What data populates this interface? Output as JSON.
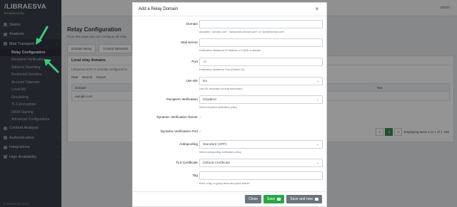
{
  "app": {
    "logo": "/LIBRAESVA",
    "subtitle": "EmailSecurity",
    "footer": "© Libraesva 2024"
  },
  "sidebar": {
    "items": [
      {
        "label": "Status",
        "icon": "gauge-icon"
      },
      {
        "label": "Analysis",
        "icon": "chart-icon"
      },
      {
        "label": "Mail Transport",
        "icon": "envelope-icon",
        "open": true
      }
    ],
    "subitems": [
      "Relay Configuration",
      "Recipient Verification",
      "Address Rewriting",
      "Restricted Senders",
      "Account Takeover",
      "Local MX",
      "Greylisting",
      "TLS Encryption",
      "DKIM Signing",
      "Advanced Configuration"
    ],
    "items_after": [
      {
        "label": "Content Analysis",
        "icon": "filter-icon"
      },
      {
        "label": "Authentication",
        "icon": "key-icon"
      },
      {
        "label": "Integrations",
        "icon": "plug-icon"
      },
      {
        "label": "High Availability",
        "icon": "cluster-icon"
      }
    ]
  },
  "topbar": {
    "user": "admin"
  },
  "page": {
    "title": "Relay Configuration",
    "description": "From this page you can configure all relay",
    "tabs": [
      "Domain Relay",
      "Trusted Networks"
    ],
    "card_title": "Local relay domains",
    "card_desc": "Libraesva ESG is actually configured to",
    "toolbar": [
      "New",
      "Search",
      "Export"
    ],
    "table_headers": [
      "Domain",
      "Mail Server",
      "Port",
      "Tag",
      "Test"
    ],
    "table_row": [
      "eample.com",
      "",
      "",
      "",
      ""
    ],
    "pager_text": "Displaying items 1 to 1 of 1",
    "pager_pages": [
      "1"
    ],
    "page_size": "100"
  },
  "modal": {
    "title": "Add a Relay Domain",
    "fields": {
      "domain": {
        "label": "Domain",
        "value": "",
        "help": "Accepted: \"domain.com\", \"subdomain.domain.com\" or \"user@domain.com\""
      },
      "mailserver": {
        "label": "Mail Server",
        "value": "",
        "help": "Destination Mailserver IP Address or FQDN or domain"
      },
      "port": {
        "label": "Port",
        "placeholder": "25",
        "help": "Destination Mailserver Port (Default 25)"
      },
      "use_mx": {
        "label": "Use MX",
        "value": "No",
        "help": "Use MX resolution for final destination"
      },
      "recipient_verification": {
        "label": "Recipient Verification",
        "value": "Disabled",
        "help": "Select recipient verification policy"
      },
      "dyn_server": {
        "label": "Dynamic Verification Server",
        "value": "–"
      },
      "dyn_port": {
        "label": "Dynamic Verification Port",
        "value": "–"
      },
      "antispoofing": {
        "label": "Antispoofing",
        "value": "Standard (SPF)",
        "help": "Select antispoofing verification policy"
      },
      "tls": {
        "label": "TLS Certificate",
        "value": "Default Certificate"
      },
      "tag": {
        "label": "Tag",
        "value": "",
        "help": "Enter a tag, to group items and quick search"
      }
    },
    "buttons": {
      "close": "Close",
      "save": "Save",
      "save_new": "Save and new"
    }
  },
  "colors": {
    "sidebar": "#3a414b",
    "save": "#28a745",
    "secondary": "#6c757d",
    "arrow": "#3ec878"
  }
}
